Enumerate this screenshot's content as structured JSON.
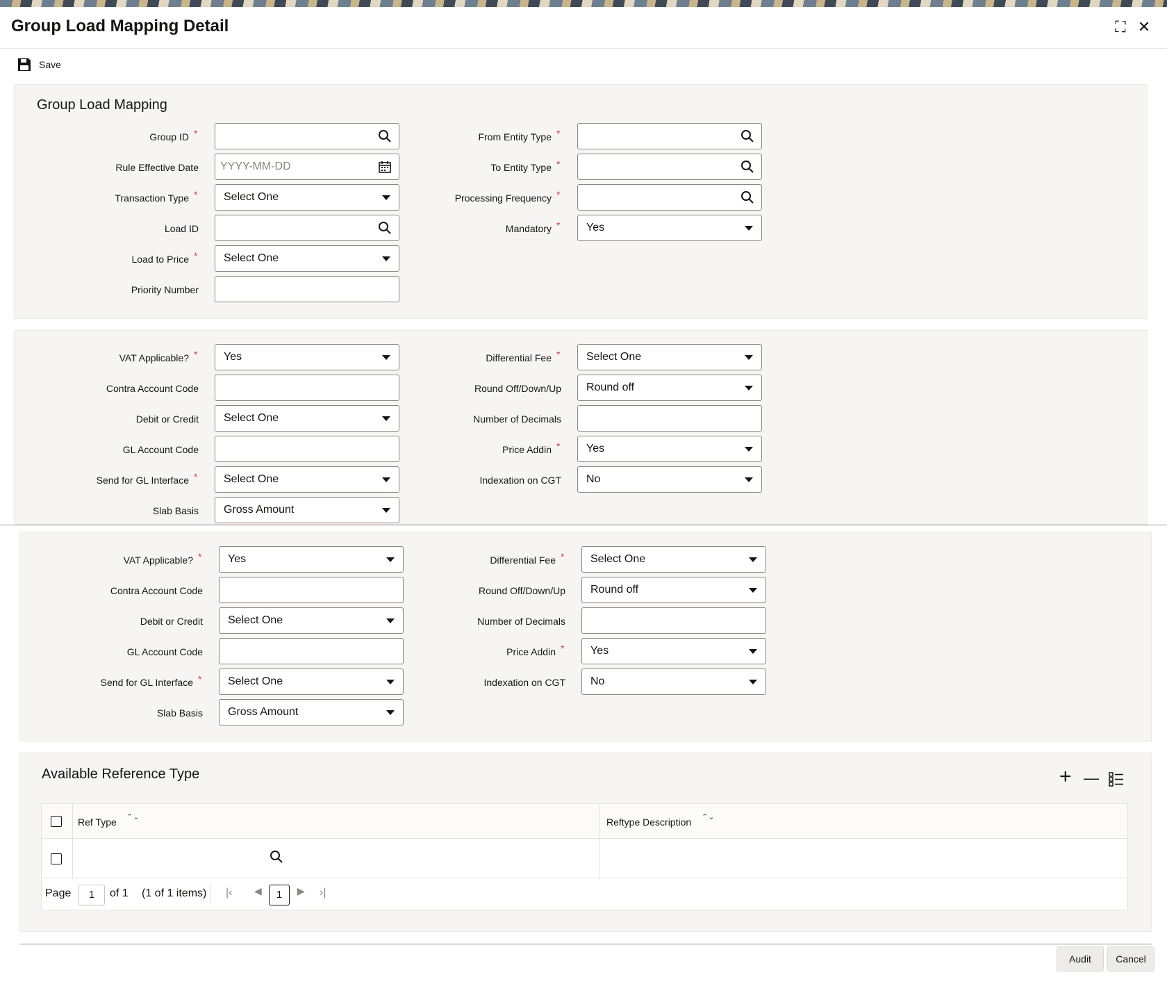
{
  "window": {
    "title": "Group Load Mapping Detail",
    "maximize_glyph": "⛶",
    "close_glyph": "✕"
  },
  "toolbar": {
    "save_label": "Save"
  },
  "mapping": {
    "section_title": "Group Load Mapping",
    "group_id_label": "Group ID",
    "rule_effective_date_label": "Rule Effective Date",
    "rule_effective_date_placeholder": "YYYY-MM-DD",
    "transaction_type_label": "Transaction Type",
    "transaction_type_value": "Select One",
    "load_id_label": "Load ID",
    "load_to_price_label": "Load to Price",
    "load_to_price_value": "Select One",
    "priority_number_label": "Priority Number",
    "from_entity_type_label": "From Entity Type",
    "to_entity_type_label": "To Entity Type",
    "processing_frequency_label": "Processing Frequency",
    "mandatory_label": "Mandatory",
    "mandatory_value": "Yes"
  },
  "fee": {
    "vat_label": "VAT Applicable?",
    "vat_value": "Yes",
    "contra_label": "Contra Account Code",
    "debit_credit_label": "Debit or Credit",
    "debit_credit_value": "Select One",
    "gl_account_label": "GL Account Code",
    "send_gl_label": "Send for GL Interface",
    "send_gl_value": "Select One",
    "slab_basis_label": "Slab Basis",
    "slab_basis_value": "Gross Amount",
    "differential_fee_label": "Differential Fee",
    "differential_fee_value": "Select One",
    "round_off_label": "Round Off/Down/Up",
    "round_off_value": "Round off",
    "decimals_label": "Number of Decimals",
    "price_addin_label": "Price Addin",
    "price_addin_value": "Yes",
    "indexation_label": "Indexation on CGT",
    "indexation_value": "No"
  },
  "reference": {
    "section_title": "Available Reference Type",
    "columns": [
      "Ref Type",
      "Reftype Description"
    ],
    "sort_glyph": "⌃⌄",
    "page_label": "Page",
    "page_value": "1",
    "of_label": "of 1",
    "items_label": "(1 of 1 items)",
    "current_page": "1",
    "add_glyph": "+",
    "remove_glyph": "—"
  },
  "footer": {
    "audit_label": "Audit",
    "cancel_label": "Cancel"
  },
  "icons": {
    "lookup": "search-icon",
    "date": "calendar-icon",
    "dropdown": "chevron-down-icon",
    "save": "floppy-disk-icon"
  },
  "colors": {
    "required": "#c74634",
    "panel": "#f6f5f3",
    "border": "#8a8682"
  }
}
